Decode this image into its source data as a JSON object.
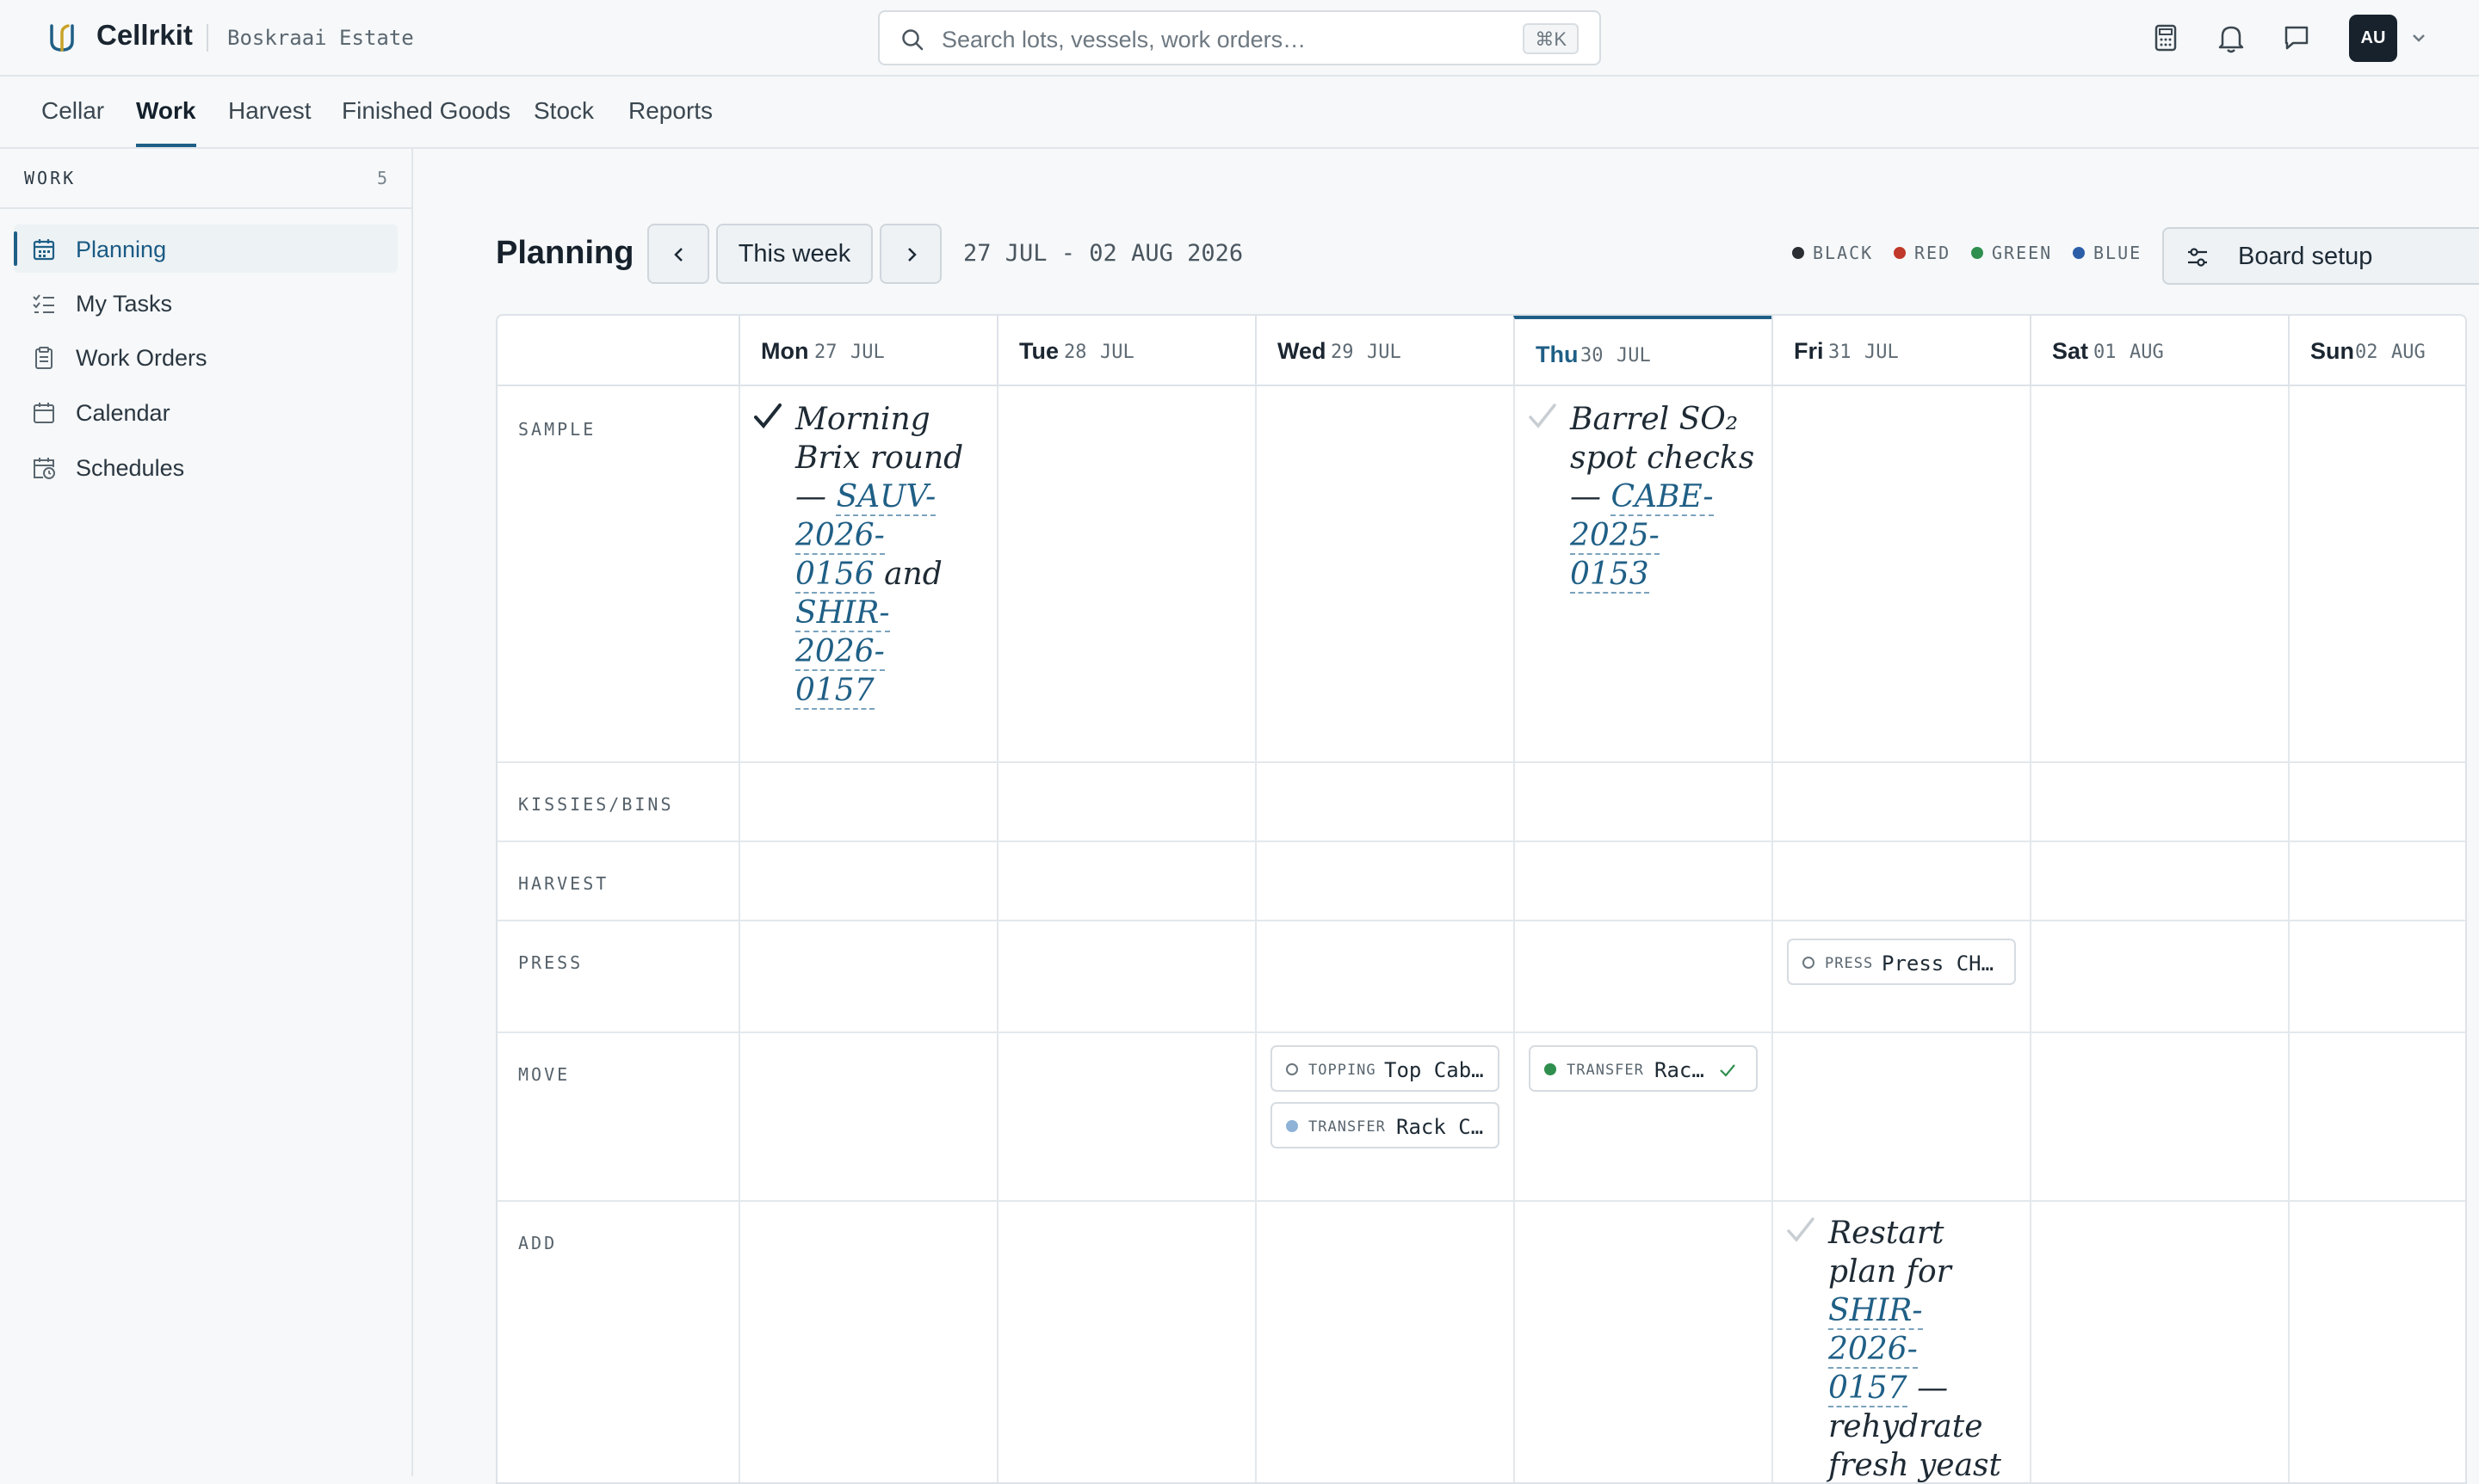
{
  "app": {
    "name": "Cellrkit",
    "estate": "Boskraai Estate"
  },
  "search": {
    "placeholder": "Search lots, vessels, work orders…",
    "shortcut": "⌘K"
  },
  "user": {
    "initials": "AU"
  },
  "nav": {
    "tabs": [
      "Cellar",
      "Work",
      "Harvest",
      "Finished Goods",
      "Stock",
      "Reports"
    ],
    "active": "Work"
  },
  "sidebar": {
    "heading": "WORK",
    "count": "5",
    "items": [
      {
        "label": "Planning",
        "icon": "calendar-grid-icon",
        "active": true
      },
      {
        "label": "My Tasks",
        "icon": "checklist-icon"
      },
      {
        "label": "Work Orders",
        "icon": "clipboard-icon"
      },
      {
        "label": "Calendar",
        "icon": "calendar-icon"
      },
      {
        "label": "Schedules",
        "icon": "calendar-clock-icon"
      }
    ]
  },
  "planning": {
    "title": "Planning",
    "this_week": "This week",
    "range": "27 JUL - 02 AUG 2026",
    "legend": [
      {
        "label": "BLACK",
        "color": "#2b2f33"
      },
      {
        "label": "RED",
        "color": "#c0392b"
      },
      {
        "label": "GREEN",
        "color": "#2f8f4e"
      },
      {
        "label": "BLUE",
        "color": "#2c5ea8"
      }
    ],
    "board_setup": "Board setup"
  },
  "days": [
    {
      "day": "Mon",
      "num": "27",
      "month": "JUL"
    },
    {
      "day": "Tue",
      "num": "28",
      "month": "JUL"
    },
    {
      "day": "Wed",
      "num": "29",
      "month": "JUL"
    },
    {
      "day": "Thu",
      "num": "30",
      "month": "JUL",
      "today": true
    },
    {
      "day": "Fri",
      "num": "31",
      "month": "JUL"
    },
    {
      "day": "Sat",
      "num": "01",
      "month": "AUG"
    },
    {
      "day": "Sun",
      "num": "02",
      "month": "AUG"
    }
  ],
  "rows": [
    "SAMPLE",
    "KISSIES/BINS",
    "HARVEST",
    "PRESS",
    "MOVE",
    "ADD"
  ],
  "notes": {
    "mon_sample": {
      "t1": "Morning",
      "t2": "Brix round",
      "t3": "— ",
      "l1": "SAUV-",
      "l2": "2026-",
      "l3": "0156",
      "t4": " and",
      "l4": "SHIR-",
      "l5": "2026-",
      "l6": "0157"
    },
    "thu_sample": {
      "t1": "Barrel SO₂",
      "t2": "spot checks",
      "t3": "— ",
      "l1": "CABE-",
      "l2": "2025-",
      "l3": "0153"
    },
    "fri_add": {
      "t1": "Restart",
      "t2": "plan for",
      "l1": "SHIR-",
      "l2": "2026-",
      "l3": "0157",
      "t3": " —",
      "t4": "rehydrate",
      "t5": "fresh yeast"
    }
  },
  "chips": {
    "fri_press": {
      "type": "PRESS",
      "text": "Press CH…"
    },
    "wed_move_1": {
      "type": "TOPPING",
      "text": "Top Cab…"
    },
    "wed_move_2": {
      "type": "TRANSFER",
      "text": "Rack C…"
    },
    "thu_move_1": {
      "type": "TRANSFER",
      "text": "Rac…"
    }
  }
}
